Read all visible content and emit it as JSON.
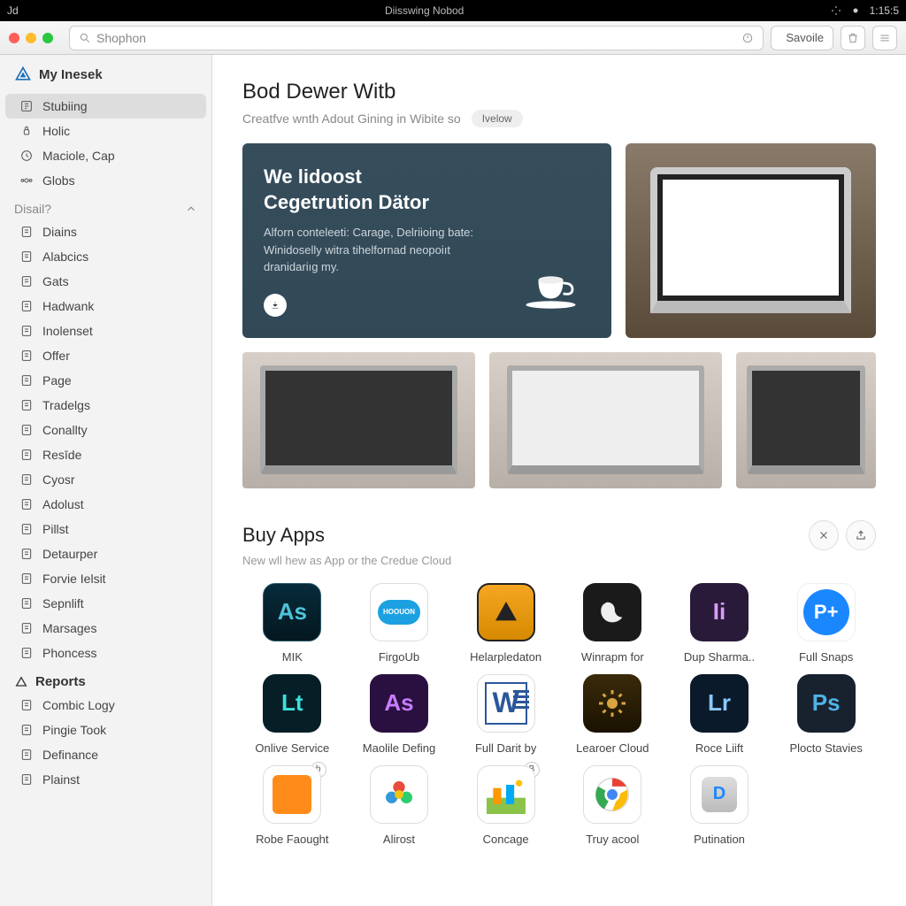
{
  "menubar": {
    "left": "Jd",
    "center": "Diisswing Nobod",
    "time": "1:15:5"
  },
  "toolbar": {
    "search_placeholder": "Shophon",
    "save": "Savoile"
  },
  "brand": "My Inesek",
  "sidebar_primary": [
    {
      "key": "stubling",
      "label": "Stubiing",
      "active": true
    },
    {
      "key": "holic",
      "label": "Holic"
    },
    {
      "key": "maciole",
      "label": "Maciole, Cap"
    },
    {
      "key": "globs",
      "label": "Globs"
    }
  ],
  "section1": {
    "label": "Disail?"
  },
  "sidebar_items": [
    "Diains",
    "Alabcics",
    "Gats",
    "Hadwank",
    "Inolenset",
    "Offer",
    "Page",
    "Tradelgs",
    "Conallty",
    "Resīde",
    "Cyosr",
    "Adolust",
    "Pillst",
    "Detaurper",
    "Forvie Ielsit",
    "Sepnlift",
    "Marsages",
    "Phoncess"
  ],
  "reports_head": "Reports",
  "reports_items": [
    "Combic Logy",
    "Pingie Took",
    "Definance",
    "Plainst"
  ],
  "page": {
    "title": "Bod Dewer Witb",
    "sub": "Creatfve wnth Adout Gining in Wibite so",
    "pill": "Ivelow"
  },
  "hero": {
    "title_a": "We lidoost",
    "title_b": "Cegetrution Dätor",
    "body": "Alforn conteleeti: Carage, Delriioing bate: Winidoselly witra tihelfornad neopoiıt dranidariıg my."
  },
  "apps_section": {
    "title": "Buy Apps",
    "sub": "New wll hew as App or the Credue Cloud"
  },
  "apps_row1": [
    {
      "label": "MIK",
      "cls": "ic-as",
      "txt": "As"
    },
    {
      "label": "FirgoUb",
      "cls": "ic-cloud",
      "txt": "HOOUON"
    },
    {
      "label": "Helarpledaton",
      "cls": "ic-amber",
      "txt": ""
    },
    {
      "label": "Winrapm for",
      "cls": "ic-dark",
      "txt": ""
    },
    {
      "label": "Dup Sharma..",
      "cls": "ic-purple",
      "txt": "Ii"
    },
    {
      "label": "Full Snaps",
      "cls": "ic-pplus",
      "txt": "P+"
    }
  ],
  "apps_row2": [
    {
      "label": "Onlive Service",
      "cls": "ic-lt",
      "txt": "Lt"
    },
    {
      "label": "Maolile Defing",
      "cls": "ic-asv",
      "txt": "As"
    },
    {
      "label": "Full Darit by",
      "cls": "ic-word",
      "txt": "W"
    },
    {
      "label": "Learoer Cloud",
      "cls": "ic-gear",
      "txt": ""
    },
    {
      "label": "Roce Liift",
      "cls": "ic-lr",
      "txt": "Lr"
    },
    {
      "label": "Plocto Stavies",
      "cls": "ic-ps",
      "txt": "Ps"
    }
  ],
  "apps_row3": [
    {
      "label": "Robe Faought",
      "cls": "ic-note",
      "txt": "",
      "badge": "b"
    },
    {
      "label": "Alirost",
      "cls": "ic-flower",
      "txt": ""
    },
    {
      "label": "Concage",
      "cls": "ic-city",
      "txt": "",
      "badge": "B"
    },
    {
      "label": "Truy acool",
      "cls": "ic-chrome",
      "txt": ""
    },
    {
      "label": "Putination",
      "cls": "ic-dbox",
      "txt": "D"
    }
  ]
}
